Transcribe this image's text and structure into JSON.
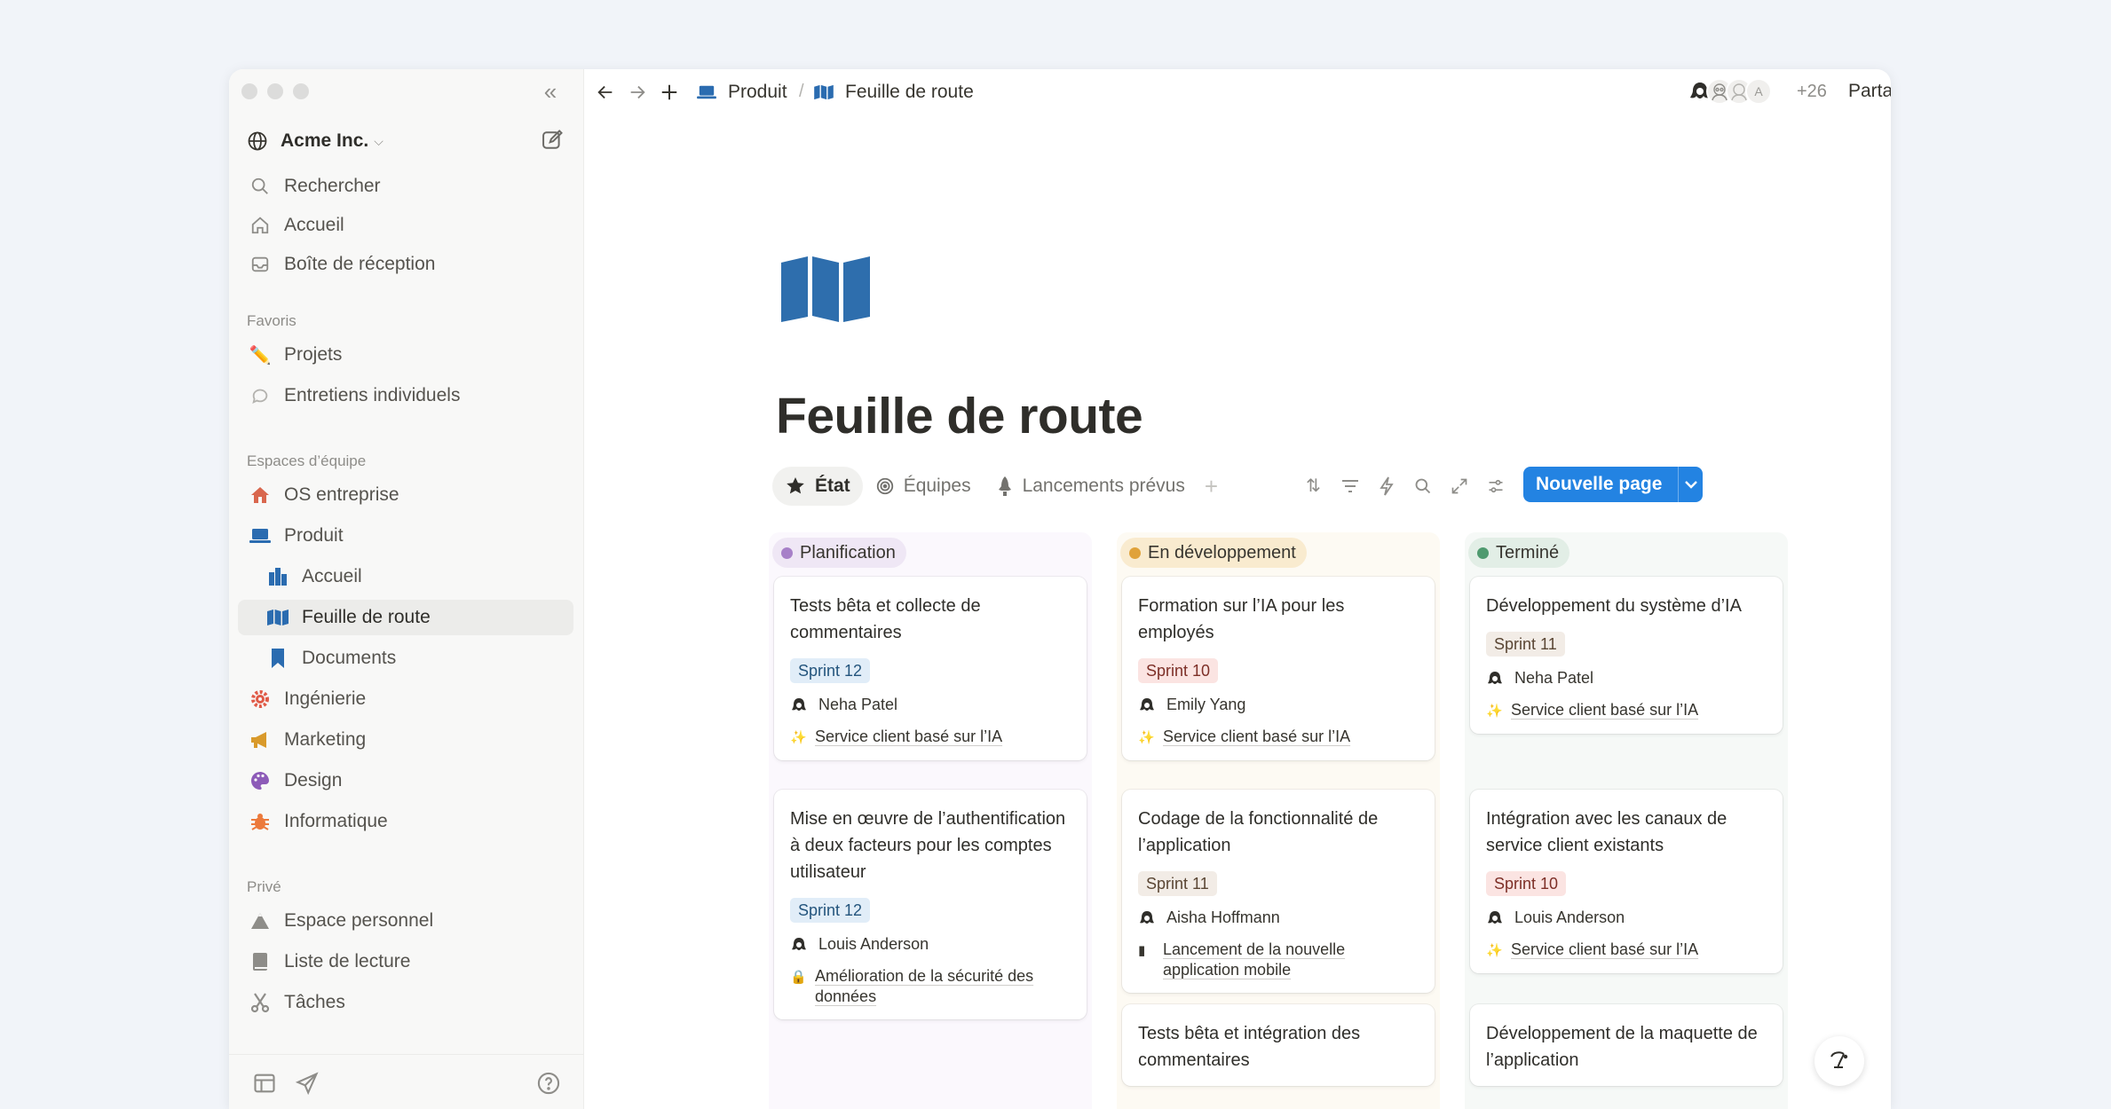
{
  "sidebar": {
    "workspace_name": "Acme Inc.",
    "search": "Rechercher",
    "home": "Accueil",
    "inbox": "Boîte de réception",
    "favorites_label": "Favoris",
    "favorites": [
      "Projets",
      "Entretiens individuels"
    ],
    "teams_label": "Espaces d’équipe",
    "teams": [
      "OS entreprise",
      "Produit",
      "Accueil",
      "Feuille de route",
      "Documents",
      "Ingénierie",
      "Marketing",
      "Design",
      "Informatique"
    ],
    "private_label": "Privé",
    "private": [
      "Espace personnel",
      "Liste de lecture",
      "Tâches"
    ]
  },
  "topbar": {
    "breadcrumb": [
      "Produit",
      "Feuille de route"
    ],
    "avatar_initial": "A",
    "extra_count": "+26",
    "share_label": "Partager"
  },
  "page": {
    "title": "Feuille de route",
    "views": [
      "État",
      "Équipes",
      "Lancements prévus"
    ],
    "new_page_label": "Nouvelle page"
  },
  "board": {
    "columns": [
      {
        "title": "Planification",
        "dot_color": "#a780c8",
        "bg": "#fbf8fd",
        "head_bg": "#efe7f5",
        "cards": [
          {
            "title": "Tests bêta et collecte de commentaires",
            "sprint": "Sprint 12",
            "person": "Neha Patel",
            "project": "Service client basé sur l’IA"
          },
          {
            "title": "Mise en œuvre de l’authentification à deux facteurs pour les comptes utilisateur",
            "sprint": "Sprint 12",
            "person": "Louis Anderson",
            "project": "Amélioration de la sécurité des données"
          }
        ]
      },
      {
        "title": "En développement",
        "dot_color": "#e0a23a",
        "bg": "#fdfaf3",
        "head_bg": "#f9ebcf",
        "cards": [
          {
            "title": "Formation sur l’IA pour les employés",
            "sprint": "Sprint 10",
            "person": "Emily Yang",
            "project": "Service client basé sur l’IA"
          },
          {
            "title": "Codage de la fonctionnalité de l’application",
            "sprint": "Sprint 11",
            "person": "Aisha Hoffmann",
            "project": "Lancement de la nouvelle application mobile"
          },
          {
            "title": "Tests bêta et intégration des commentaires"
          }
        ]
      },
      {
        "title": "Terminé",
        "dot_color": "#4f9a6f",
        "bg": "#f6f9f7",
        "head_bg": "#e2eee6",
        "cards": [
          {
            "title": "Développement du système d’IA",
            "sprint": "Sprint 11",
            "person": "Neha Patel",
            "project": "Service client basé sur l’IA"
          },
          {
            "title": "Intégration avec les canaux de service client existants",
            "sprint": "Sprint 10",
            "person": "Louis Anderson",
            "project": "Service client basé sur l’IA"
          },
          {
            "title": "Développement de la maquette de l’application"
          }
        ]
      }
    ]
  },
  "sprint_colors": {
    "Sprint 10": {
      "bg": "#fbe4e2",
      "fg": "#7d2f27"
    },
    "Sprint 11": {
      "bg": "#f2ece6",
      "fg": "#5a4634"
    },
    "Sprint 12": {
      "bg": "#e1edf8",
      "fg": "#24557d"
    }
  }
}
